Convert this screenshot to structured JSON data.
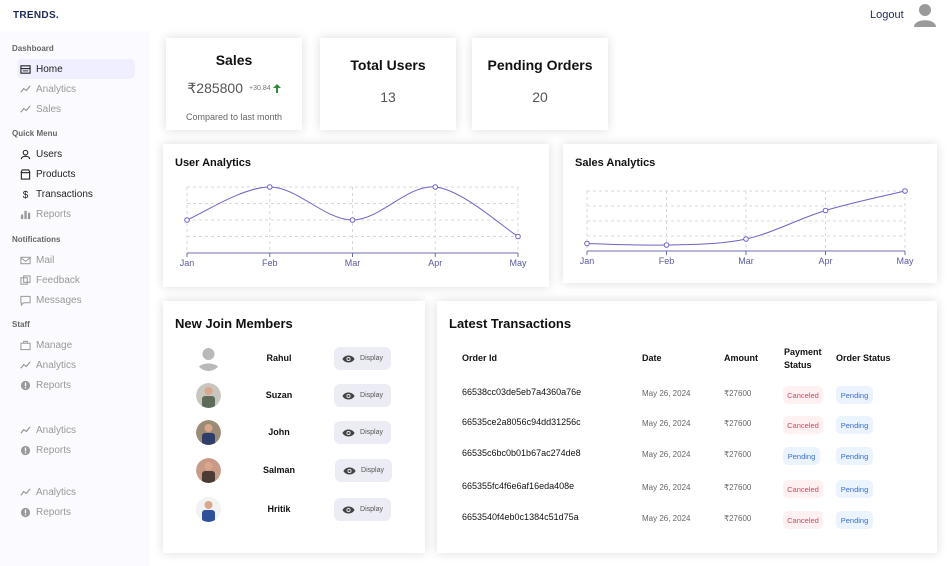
{
  "app": {
    "logo": "TRENDS.",
    "logout_label": "Logout"
  },
  "sidebar": {
    "sections": [
      {
        "title": "Dashboard",
        "items": [
          {
            "label": "Home",
            "icon": "home-icon",
            "state": "active"
          },
          {
            "label": "Analytics",
            "icon": "trend-icon",
            "state": "muted"
          },
          {
            "label": "Sales",
            "icon": "trend-icon",
            "state": "muted"
          }
        ]
      },
      {
        "title": "Quick Menu",
        "items": [
          {
            "label": "Users",
            "icon": "user-icon",
            "state": "normal"
          },
          {
            "label": "Products",
            "icon": "store-icon",
            "state": "normal"
          },
          {
            "label": "Transactions",
            "icon": "dollar-icon",
            "state": "normal"
          },
          {
            "label": "Reports",
            "icon": "bar-chart-icon",
            "state": "muted"
          }
        ]
      },
      {
        "title": "Notifications",
        "items": [
          {
            "label": "Mail",
            "icon": "mail-icon",
            "state": "muted"
          },
          {
            "label": "Feedback",
            "icon": "feedback-icon",
            "state": "muted"
          },
          {
            "label": "Messages",
            "icon": "message-icon",
            "state": "muted"
          }
        ]
      },
      {
        "title": "Staff",
        "items": [
          {
            "label": "Manage",
            "icon": "briefcase-icon",
            "state": "muted"
          },
          {
            "label": "Analytics",
            "icon": "trend-icon",
            "state": "muted"
          },
          {
            "label": "Reports",
            "icon": "alert-icon",
            "state": "muted"
          }
        ]
      },
      {
        "title": "",
        "items": [
          {
            "label": "Analytics",
            "icon": "trend-icon",
            "state": "muted"
          },
          {
            "label": "Reports",
            "icon": "alert-icon",
            "state": "muted"
          }
        ]
      },
      {
        "title": "",
        "items": [
          {
            "label": "Analytics",
            "icon": "trend-icon",
            "state": "muted"
          },
          {
            "label": "Reports",
            "icon": "alert-icon",
            "state": "muted"
          }
        ]
      }
    ]
  },
  "kpis": {
    "sales": {
      "title": "Sales",
      "value": "₹285800",
      "delta": "+30.84",
      "subtitle": "Compared to last month"
    },
    "total_users": {
      "title": "Total Users",
      "value": "13"
    },
    "pending_orders": {
      "title": "Pending Orders",
      "value": "20"
    }
  },
  "chart_data": [
    {
      "type": "line",
      "title": "User Analytics",
      "categories": [
        "Jan",
        "Feb",
        "Mar",
        "Apr",
        "May"
      ],
      "series": [
        {
          "values": [
            2,
            4,
            2,
            4,
            1
          ]
        }
      ],
      "ylim": [
        0,
        4
      ],
      "grid": true,
      "color": "#6c63c7"
    },
    {
      "type": "line",
      "title": "Sales Analytics",
      "categories": [
        "Jan",
        "Feb",
        "Mar",
        "Apr",
        "May"
      ],
      "series": [
        {
          "values": [
            0.5,
            0.4,
            0.8,
            2.7,
            4.0
          ]
        }
      ],
      "ylim": [
        0,
        4
      ],
      "grid": true,
      "color": "#6c63c7"
    }
  ],
  "members": {
    "title": "New Join Members",
    "display_label": "Display",
    "list": [
      {
        "name": "Rahul",
        "avatar": "default-avatar"
      },
      {
        "name": "Suzan",
        "avatar": "photo"
      },
      {
        "name": "John",
        "avatar": "photo"
      },
      {
        "name": "Salman",
        "avatar": "photo"
      },
      {
        "name": "Hritik",
        "avatar": "photo"
      }
    ]
  },
  "transactions": {
    "title": "Latest Transactions",
    "headers": {
      "order_id": "Order Id",
      "date": "Date",
      "amount": "Amount",
      "payment_status_1": "Payment",
      "payment_status_2": "Status",
      "order_status": "Order Status"
    },
    "rows": [
      {
        "order_id": "66538cc03de5eb7a4360a76e",
        "date": "May 26, 2024",
        "amount": "₹27600",
        "payment_status": "Canceled",
        "order_status": "Pending"
      },
      {
        "order_id": "66535ce2a8056c94dd31256c",
        "date": "May 26, 2024",
        "amount": "₹27600",
        "payment_status": "Canceled",
        "order_status": "Pending"
      },
      {
        "order_id": "66535c6bc0b01b67ac274de8",
        "date": "May 26, 2024",
        "amount": "₹27600",
        "payment_status": "Pending",
        "order_status": "Pending"
      },
      {
        "order_id": "665355fc4f6e6af16eda408e",
        "date": "May 26, 2024",
        "amount": "₹27600",
        "payment_status": "Canceled",
        "order_status": "Pending"
      },
      {
        "order_id": "6653540f4eb0c1384c51d75a",
        "date": "May 26, 2024",
        "amount": "₹27600",
        "payment_status": "Canceled",
        "order_status": "Pending"
      }
    ]
  }
}
